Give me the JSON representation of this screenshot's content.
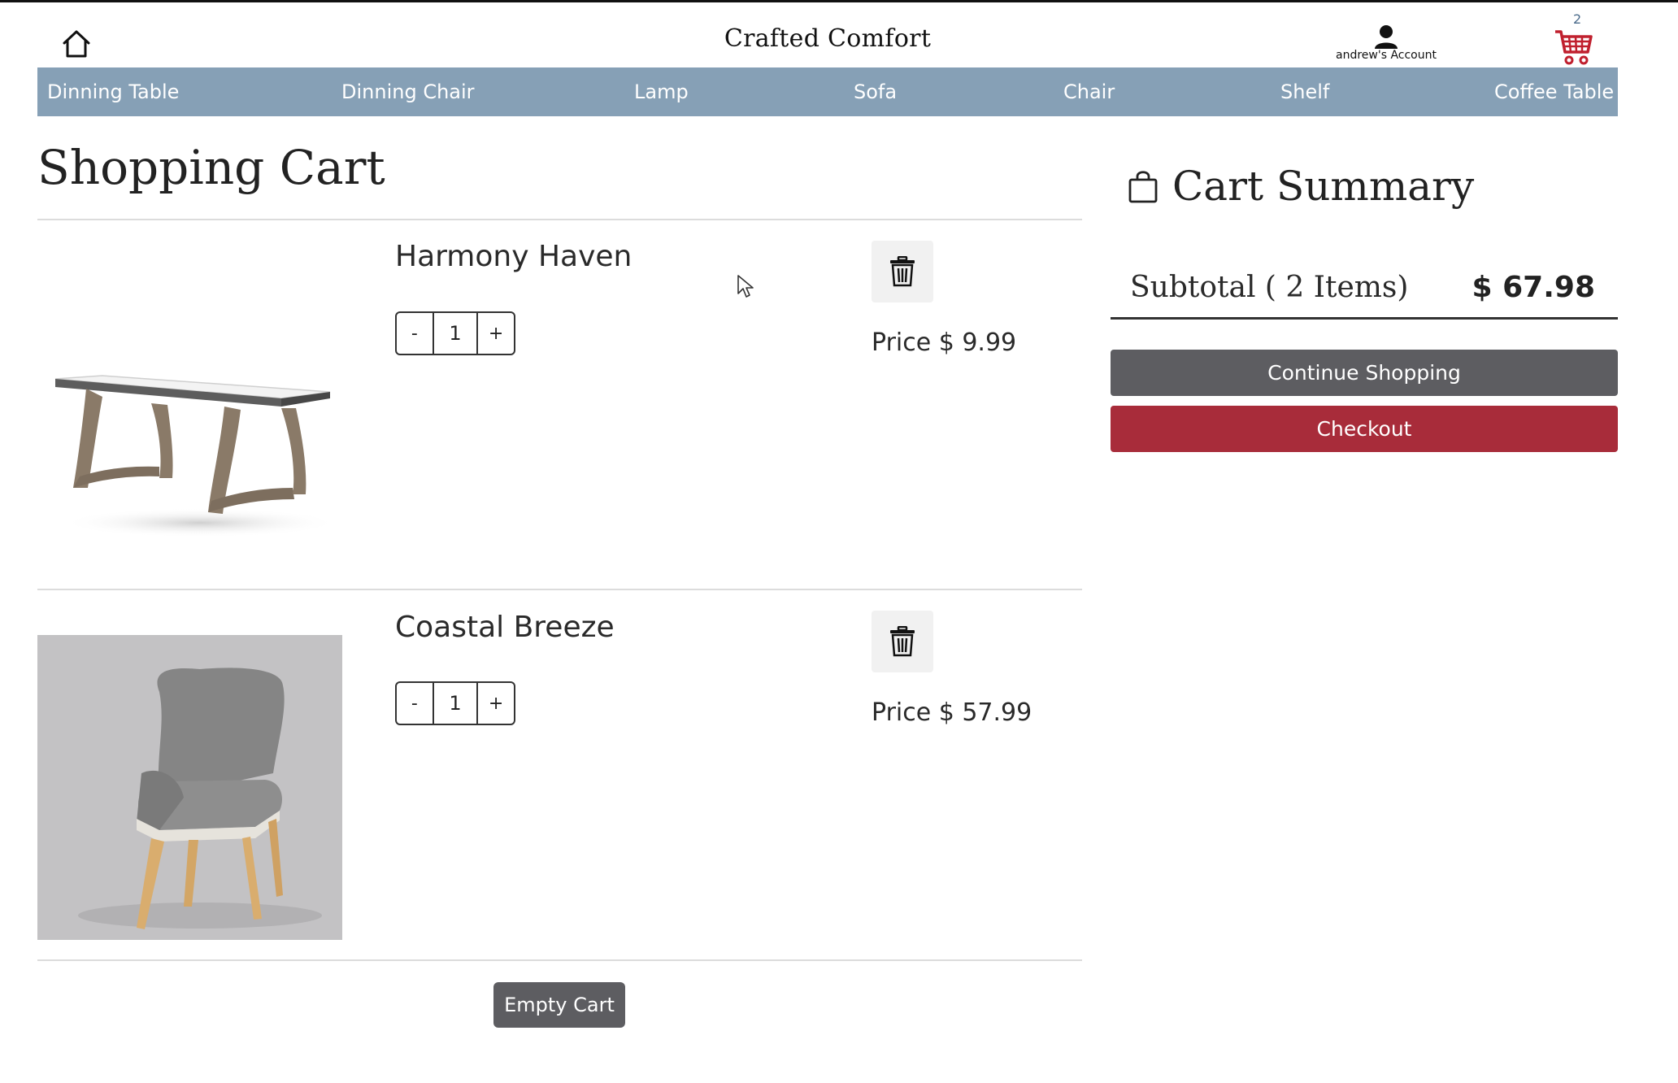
{
  "header": {
    "brand": "Crafted Comfort",
    "home_icon": "home-icon",
    "account_icon": "user-icon",
    "account_label": "andrew's Account",
    "cart_icon": "shopping-cart-icon",
    "cart_count": "2"
  },
  "nav": {
    "items": [
      {
        "label": "Dinning Table"
      },
      {
        "label": "Dinning Chair"
      },
      {
        "label": "Lamp"
      },
      {
        "label": "Sofa"
      },
      {
        "label": "Chair"
      },
      {
        "label": "Shelf"
      },
      {
        "label": "Coffee Table"
      }
    ]
  },
  "cart": {
    "title": "Shopping Cart",
    "items": [
      {
        "name": "Harmony Haven",
        "qty": "1",
        "price_label": "Price $ 9.99",
        "image": "dining-table-photo",
        "minus": "-",
        "plus": "+"
      },
      {
        "name": "Coastal Breeze",
        "qty": "1",
        "price_label": "Price $ 57.99",
        "image": "dining-chair-photo",
        "minus": "-",
        "plus": "+"
      }
    ],
    "empty_label": "Empty Cart"
  },
  "summary": {
    "title": "Cart Summary",
    "icon": "shopping-bag-icon",
    "subtotal_label": "Subtotal ( 2 Items)",
    "subtotal_value": "$ 67.98",
    "continue_label": "Continue Shopping",
    "checkout_label": "Checkout"
  },
  "colors": {
    "nav_bg": "#86a0b6",
    "checkout": "#a82c3a",
    "dark_button": "#5d5d61",
    "cart_icon": "#c0202e"
  }
}
